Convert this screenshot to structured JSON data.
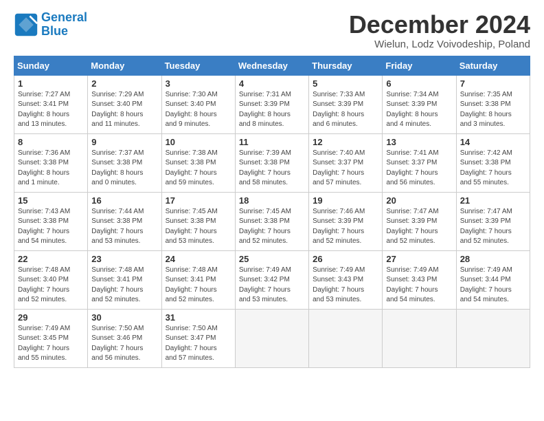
{
  "header": {
    "logo_line1": "General",
    "logo_line2": "Blue",
    "month_title": "December 2024",
    "subtitle": "Wielun, Lodz Voivodeship, Poland"
  },
  "weekdays": [
    "Sunday",
    "Monday",
    "Tuesday",
    "Wednesday",
    "Thursday",
    "Friday",
    "Saturday"
  ],
  "weeks": [
    [
      {
        "day": "1",
        "info": "Sunrise: 7:27 AM\nSunset: 3:41 PM\nDaylight: 8 hours\nand 13 minutes."
      },
      {
        "day": "2",
        "info": "Sunrise: 7:29 AM\nSunset: 3:40 PM\nDaylight: 8 hours\nand 11 minutes."
      },
      {
        "day": "3",
        "info": "Sunrise: 7:30 AM\nSunset: 3:40 PM\nDaylight: 8 hours\nand 9 minutes."
      },
      {
        "day": "4",
        "info": "Sunrise: 7:31 AM\nSunset: 3:39 PM\nDaylight: 8 hours\nand 8 minutes."
      },
      {
        "day": "5",
        "info": "Sunrise: 7:33 AM\nSunset: 3:39 PM\nDaylight: 8 hours\nand 6 minutes."
      },
      {
        "day": "6",
        "info": "Sunrise: 7:34 AM\nSunset: 3:39 PM\nDaylight: 8 hours\nand 4 minutes."
      },
      {
        "day": "7",
        "info": "Sunrise: 7:35 AM\nSunset: 3:38 PM\nDaylight: 8 hours\nand 3 minutes."
      }
    ],
    [
      {
        "day": "8",
        "info": "Sunrise: 7:36 AM\nSunset: 3:38 PM\nDaylight: 8 hours\nand 1 minute."
      },
      {
        "day": "9",
        "info": "Sunrise: 7:37 AM\nSunset: 3:38 PM\nDaylight: 8 hours\nand 0 minutes."
      },
      {
        "day": "10",
        "info": "Sunrise: 7:38 AM\nSunset: 3:38 PM\nDaylight: 7 hours\nand 59 minutes."
      },
      {
        "day": "11",
        "info": "Sunrise: 7:39 AM\nSunset: 3:38 PM\nDaylight: 7 hours\nand 58 minutes."
      },
      {
        "day": "12",
        "info": "Sunrise: 7:40 AM\nSunset: 3:37 PM\nDaylight: 7 hours\nand 57 minutes."
      },
      {
        "day": "13",
        "info": "Sunrise: 7:41 AM\nSunset: 3:37 PM\nDaylight: 7 hours\nand 56 minutes."
      },
      {
        "day": "14",
        "info": "Sunrise: 7:42 AM\nSunset: 3:38 PM\nDaylight: 7 hours\nand 55 minutes."
      }
    ],
    [
      {
        "day": "15",
        "info": "Sunrise: 7:43 AM\nSunset: 3:38 PM\nDaylight: 7 hours\nand 54 minutes."
      },
      {
        "day": "16",
        "info": "Sunrise: 7:44 AM\nSunset: 3:38 PM\nDaylight: 7 hours\nand 53 minutes."
      },
      {
        "day": "17",
        "info": "Sunrise: 7:45 AM\nSunset: 3:38 PM\nDaylight: 7 hours\nand 53 minutes."
      },
      {
        "day": "18",
        "info": "Sunrise: 7:45 AM\nSunset: 3:38 PM\nDaylight: 7 hours\nand 52 minutes."
      },
      {
        "day": "19",
        "info": "Sunrise: 7:46 AM\nSunset: 3:39 PM\nDaylight: 7 hours\nand 52 minutes."
      },
      {
        "day": "20",
        "info": "Sunrise: 7:47 AM\nSunset: 3:39 PM\nDaylight: 7 hours\nand 52 minutes."
      },
      {
        "day": "21",
        "info": "Sunrise: 7:47 AM\nSunset: 3:39 PM\nDaylight: 7 hours\nand 52 minutes."
      }
    ],
    [
      {
        "day": "22",
        "info": "Sunrise: 7:48 AM\nSunset: 3:40 PM\nDaylight: 7 hours\nand 52 minutes."
      },
      {
        "day": "23",
        "info": "Sunrise: 7:48 AM\nSunset: 3:41 PM\nDaylight: 7 hours\nand 52 minutes."
      },
      {
        "day": "24",
        "info": "Sunrise: 7:48 AM\nSunset: 3:41 PM\nDaylight: 7 hours\nand 52 minutes."
      },
      {
        "day": "25",
        "info": "Sunrise: 7:49 AM\nSunset: 3:42 PM\nDaylight: 7 hours\nand 53 minutes."
      },
      {
        "day": "26",
        "info": "Sunrise: 7:49 AM\nSunset: 3:43 PM\nDaylight: 7 hours\nand 53 minutes."
      },
      {
        "day": "27",
        "info": "Sunrise: 7:49 AM\nSunset: 3:43 PM\nDaylight: 7 hours\nand 54 minutes."
      },
      {
        "day": "28",
        "info": "Sunrise: 7:49 AM\nSunset: 3:44 PM\nDaylight: 7 hours\nand 54 minutes."
      }
    ],
    [
      {
        "day": "29",
        "info": "Sunrise: 7:49 AM\nSunset: 3:45 PM\nDaylight: 7 hours\nand 55 minutes."
      },
      {
        "day": "30",
        "info": "Sunrise: 7:50 AM\nSunset: 3:46 PM\nDaylight: 7 hours\nand 56 minutes."
      },
      {
        "day": "31",
        "info": "Sunrise: 7:50 AM\nSunset: 3:47 PM\nDaylight: 7 hours\nand 57 minutes."
      },
      null,
      null,
      null,
      null
    ]
  ]
}
